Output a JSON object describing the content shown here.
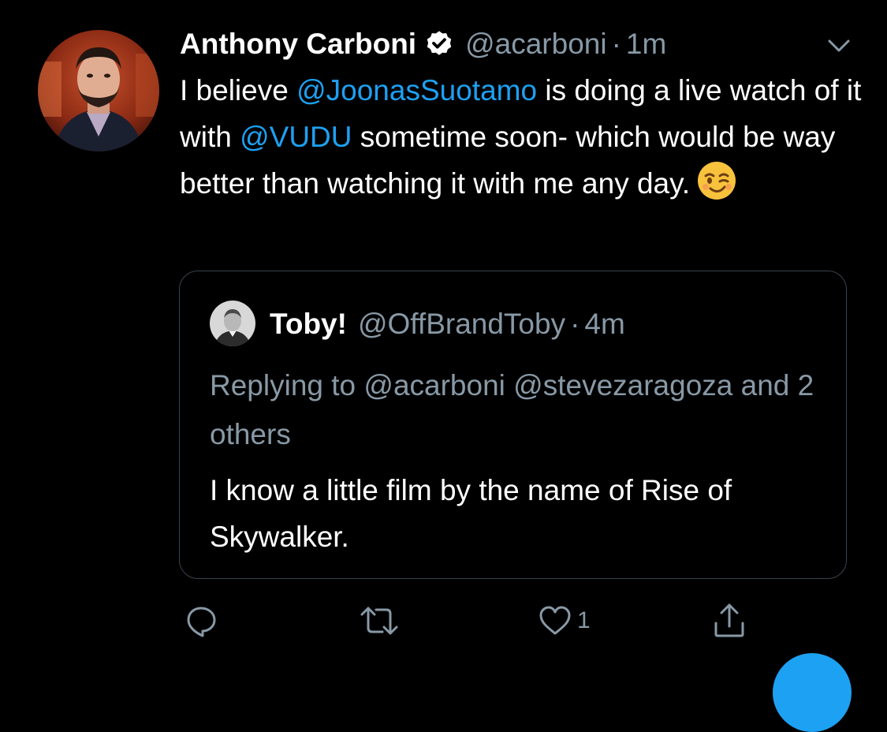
{
  "tweet": {
    "display_name": "Anthony Carboni",
    "handle": "@acarboni",
    "separator": "·",
    "time": "1m",
    "avatar_icon": "author-avatar-photo",
    "verified_icon": "verified-badge-icon",
    "menu_icon": "chevron-down-icon",
    "text": {
      "part1": "I believe ",
      "mention1": "@JoonasSuotamo",
      "part2": " is doing a live watch of it with ",
      "mention2": "@VUDU",
      "part3": " sometime soon- which would be way better than watching it with me any day.",
      "emoji": "winking-face-emoji"
    }
  },
  "quoted_tweet": {
    "display_name": "Toby!",
    "handle": "@OffBrandToby",
    "separator": "·",
    "time": "4m",
    "avatar_icon": "quoted-author-avatar-photo",
    "replying_to": "Replying to @acarboni @stevezaragoza and 2 others",
    "text": "I know a little film by the name of Rise of Skywalker."
  },
  "actions": {
    "reply_icon": "reply-icon",
    "retweet_icon": "retweet-icon",
    "like_icon": "heart-icon",
    "like_count": "1",
    "share_icon": "share-icon"
  },
  "colors": {
    "background": "#000000",
    "text_primary": "#ffffff",
    "text_secondary": "#8899a6",
    "link": "#1da1f2",
    "border": "#38444d"
  }
}
